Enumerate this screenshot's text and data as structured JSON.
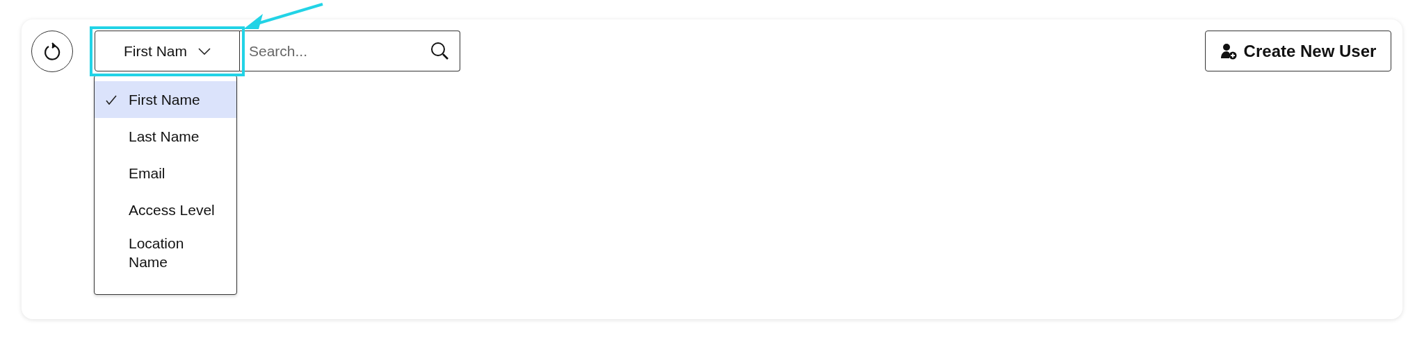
{
  "field_selector": {
    "value": "First Nam"
  },
  "search": {
    "placeholder": "Search..."
  },
  "field_menu": {
    "items": [
      {
        "label": "First Name",
        "selected": true
      },
      {
        "label": "Last Name",
        "selected": false
      },
      {
        "label": "Email",
        "selected": false
      },
      {
        "label": "Access Level",
        "selected": false
      },
      {
        "label": "Location Name",
        "selected": false
      }
    ]
  },
  "create_button": {
    "label": "Create New User"
  }
}
